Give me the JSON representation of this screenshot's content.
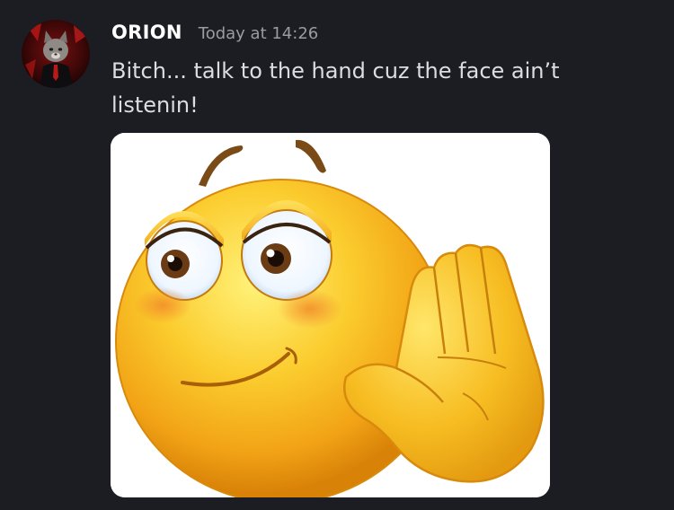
{
  "message": {
    "author": {
      "username": "ORION",
      "avatar_icon": "avatar-icon"
    },
    "timestamp": "Today at 14:26",
    "content": "Bitch... talk to the hand cuz the face ain’t listenin!",
    "attachment": {
      "type": "image",
      "image_icon": "talk-to-the-hand-emoji-icon"
    }
  },
  "colors": {
    "background": "#1c1d22",
    "username": "#ffffff",
    "timestamp": "#9a9ca3",
    "text": "#dcdde1",
    "emoji_yellow": "#f6b91d"
  }
}
